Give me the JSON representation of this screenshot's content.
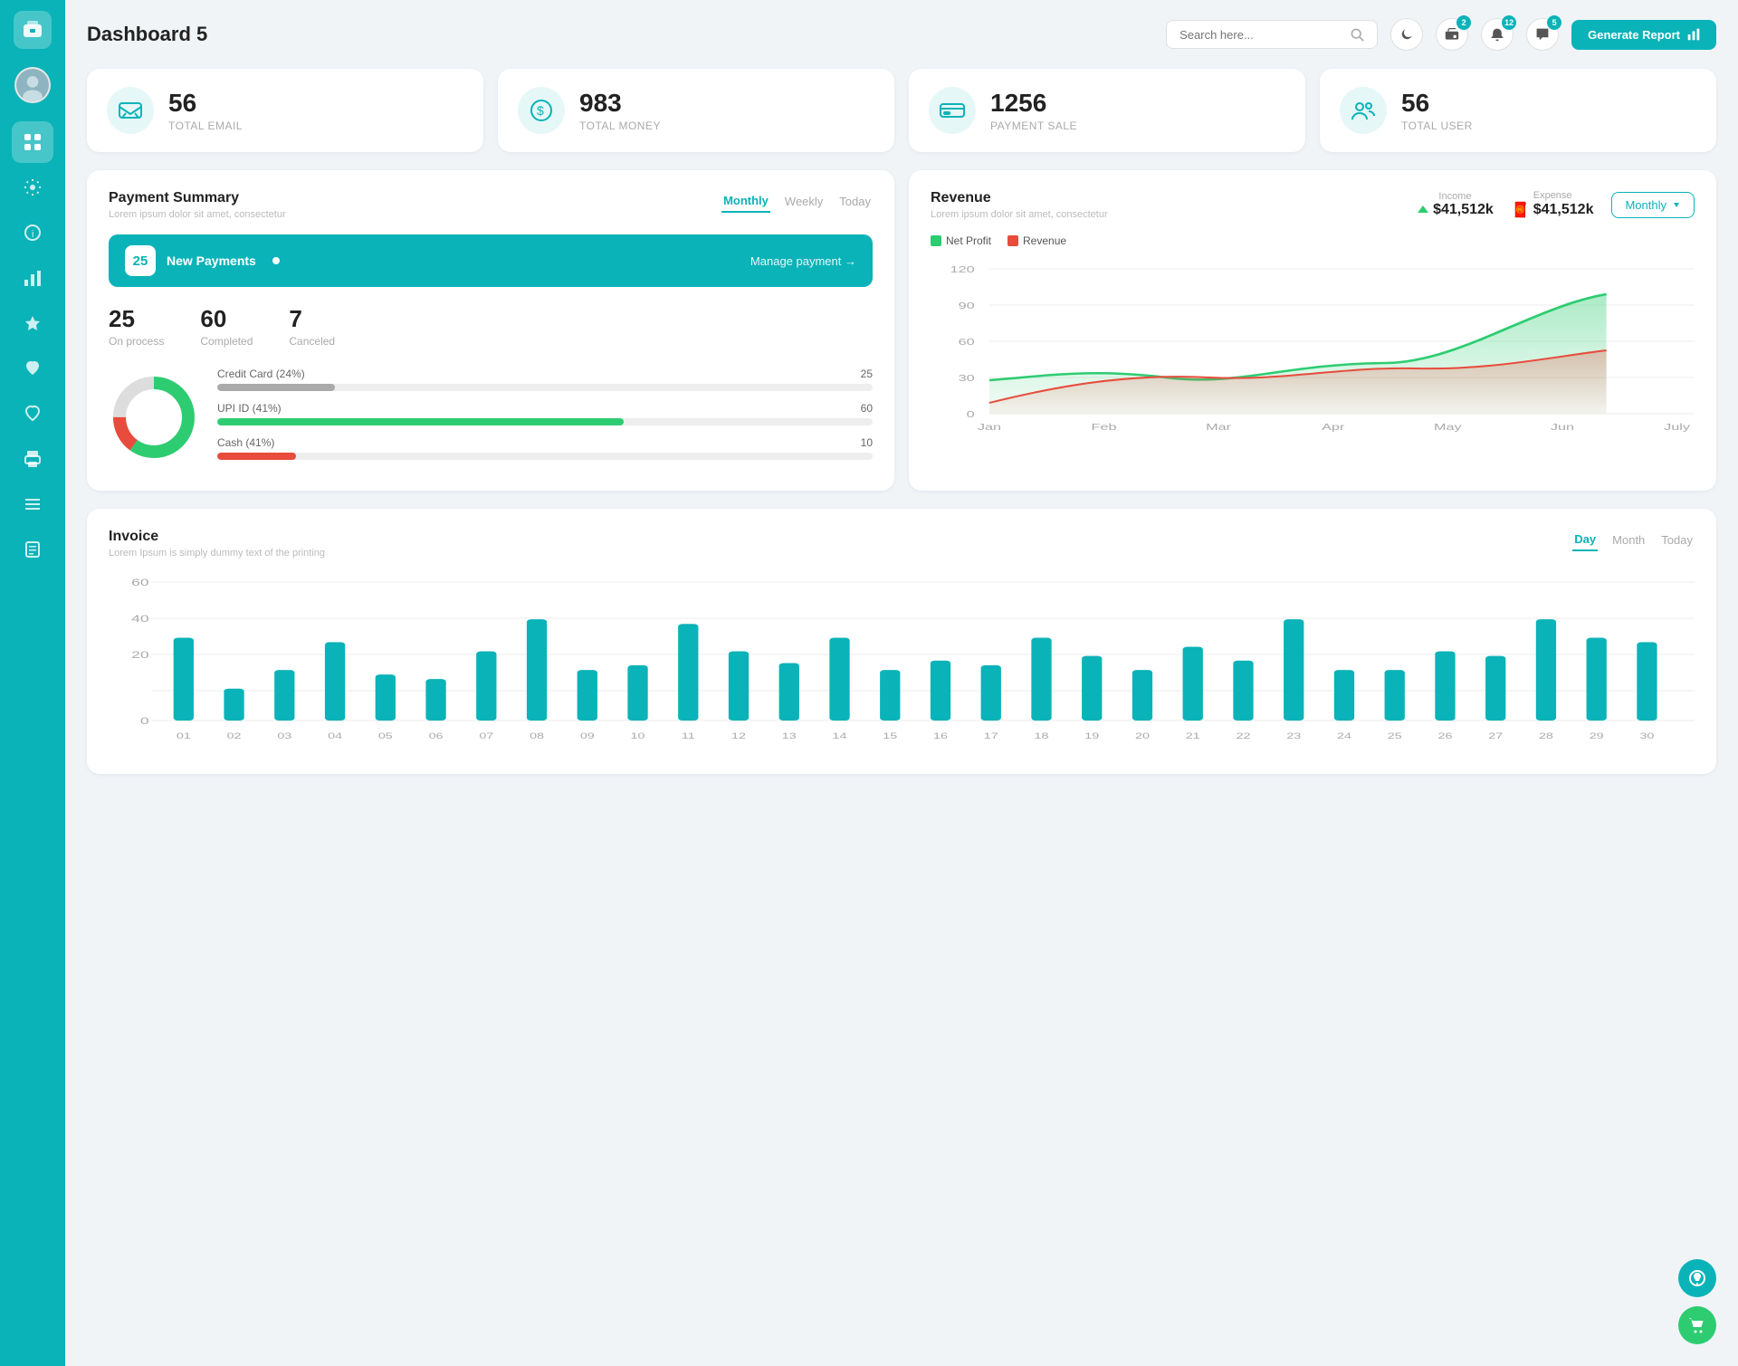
{
  "sidebar": {
    "items": [
      {
        "id": "wallet",
        "icon": "💼",
        "active": false
      },
      {
        "id": "dashboard",
        "icon": "⊞",
        "active": true
      },
      {
        "id": "settings",
        "icon": "⚙",
        "active": false
      },
      {
        "id": "info",
        "icon": "ℹ",
        "active": false
      },
      {
        "id": "analytics",
        "icon": "📊",
        "active": false
      },
      {
        "id": "star",
        "icon": "★",
        "active": false
      },
      {
        "id": "heart",
        "icon": "♥",
        "active": false
      },
      {
        "id": "heart2",
        "icon": "♡",
        "active": false
      },
      {
        "id": "print",
        "icon": "🖨",
        "active": false
      },
      {
        "id": "list",
        "icon": "≡",
        "active": false
      },
      {
        "id": "doc",
        "icon": "📋",
        "active": false
      }
    ]
  },
  "header": {
    "title": "Dashboard 5",
    "search_placeholder": "Search here...",
    "badge1": "2",
    "badge2": "12",
    "badge3": "5",
    "generate_btn": "Generate Report"
  },
  "stats": [
    {
      "id": "email",
      "num": "56",
      "label": "TOTAL EMAIL",
      "icon": "📧"
    },
    {
      "id": "money",
      "num": "983",
      "label": "TOTAL MONEY",
      "icon": "$"
    },
    {
      "id": "payment",
      "num": "1256",
      "label": "PAYMENT SALE",
      "icon": "💳"
    },
    {
      "id": "user",
      "num": "56",
      "label": "TOTAL USER",
      "icon": "👥"
    }
  ],
  "payment_summary": {
    "title": "Payment Summary",
    "sub": "Lorem ipsum dolor sit amet, consectetur",
    "tabs": [
      "Monthly",
      "Weekly",
      "Today"
    ],
    "active_tab": "Monthly",
    "new_payment_count": "25",
    "new_payment_label": "New Payments",
    "manage_link": "Manage payment →",
    "on_process": "25",
    "on_process_label": "On process",
    "completed": "60",
    "completed_label": "Completed",
    "canceled": "7",
    "canceled_label": "Canceled",
    "bars": [
      {
        "label": "Credit Card (24%)",
        "width": 18,
        "color": "#aaa",
        "val": "25"
      },
      {
        "label": "UPI ID (41%)",
        "width": 60,
        "color": "#2ecc71",
        "val": "60"
      },
      {
        "label": "Cash (41%)",
        "width": 12,
        "color": "#e74c3c",
        "val": "10"
      }
    ],
    "donut_segments": [
      {
        "color": "#2ecc71",
        "pct": 60
      },
      {
        "color": "#e74c3c",
        "pct": 15
      },
      {
        "color": "#ddd",
        "pct": 25
      }
    ]
  },
  "revenue": {
    "title": "Revenue",
    "sub": "Lorem ipsum dolor sit amet, consectetur",
    "tabs": [
      "Monthly"
    ],
    "active_tab": "Monthly",
    "legend": [
      {
        "label": "Net Profit",
        "color": "#2ecc71"
      },
      {
        "label": "Revenue",
        "color": "#e74c3c"
      }
    ],
    "income_label": "Income",
    "income_val": "$41,512k",
    "expense_label": "Expense",
    "expense_val": "$41,512k",
    "months": [
      "Jan",
      "Feb",
      "Mar",
      "Apr",
      "May",
      "Jun",
      "July"
    ],
    "y_labels": [
      "120",
      "90",
      "60",
      "30",
      "0"
    ],
    "net_profit_data": [
      28,
      32,
      38,
      30,
      42,
      90,
      100
    ],
    "revenue_data": [
      10,
      28,
      38,
      45,
      35,
      50,
      55
    ]
  },
  "invoice": {
    "title": "Invoice",
    "sub": "Lorem Ipsum is simply dummy text of the printing",
    "tabs": [
      "Day",
      "Month",
      "Today"
    ],
    "active_tab": "Day",
    "y_labels": [
      "60",
      "40",
      "20",
      "0"
    ],
    "x_labels": [
      "01",
      "02",
      "03",
      "04",
      "05",
      "06",
      "07",
      "08",
      "09",
      "10",
      "11",
      "12",
      "13",
      "14",
      "15",
      "16",
      "17",
      "18",
      "19",
      "20",
      "21",
      "22",
      "23",
      "24",
      "25",
      "26",
      "27",
      "28",
      "29",
      "30"
    ],
    "bar_data": [
      36,
      14,
      22,
      34,
      20,
      18,
      30,
      44,
      22,
      24,
      42,
      30,
      25,
      36,
      22,
      26,
      24,
      36,
      28,
      22,
      32,
      26,
      44,
      22,
      22,
      30,
      28,
      44,
      36,
      34
    ]
  },
  "float_btns": [
    {
      "id": "support",
      "icon": "💬",
      "color": "#0ab3b8"
    },
    {
      "id": "cart",
      "icon": "🛒",
      "color": "#2ecc71"
    }
  ]
}
